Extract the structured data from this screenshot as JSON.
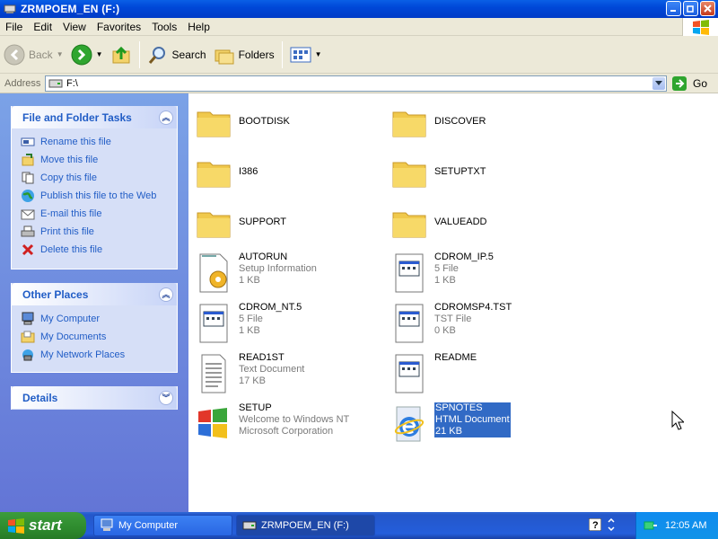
{
  "window": {
    "title": "ZRMPOEM_EN (F:)"
  },
  "menu": [
    "File",
    "Edit",
    "View",
    "Favorites",
    "Tools",
    "Help"
  ],
  "toolbar": {
    "back": "Back",
    "search": "Search",
    "folders": "Folders"
  },
  "address": {
    "label": "Address",
    "value": "F:\\",
    "go": "Go"
  },
  "tasks": {
    "file_tasks": {
      "title": "File and Folder Tasks",
      "items": [
        {
          "label": "Rename this file",
          "icon": "rename-icon"
        },
        {
          "label": "Move this file",
          "icon": "move-icon"
        },
        {
          "label": "Copy this file",
          "icon": "copy-icon"
        },
        {
          "label": "Publish this file to the Web",
          "icon": "globe-icon"
        },
        {
          "label": "E-mail this file",
          "icon": "email-icon"
        },
        {
          "label": "Print this file",
          "icon": "printer-icon"
        },
        {
          "label": "Delete this file",
          "icon": "delete-icon"
        }
      ]
    },
    "other_places": {
      "title": "Other Places",
      "items": [
        {
          "label": "My Computer",
          "icon": "computer-icon"
        },
        {
          "label": "My Documents",
          "icon": "documents-folder-icon"
        },
        {
          "label": "My Network Places",
          "icon": "network-icon"
        }
      ]
    },
    "details": {
      "title": "Details"
    }
  },
  "files": [
    {
      "name": "BOOTDISK",
      "type": "folder"
    },
    {
      "name": "DISCOVER",
      "type": "folder"
    },
    {
      "name": "I386",
      "type": "folder"
    },
    {
      "name": "SETUPTXT",
      "type": "folder"
    },
    {
      "name": "SUPPORT",
      "type": "folder"
    },
    {
      "name": "VALUEADD",
      "type": "folder"
    },
    {
      "name": "AUTORUN",
      "line2": "Setup Information",
      "line3": "1 KB",
      "type": "setup-info"
    },
    {
      "name": "CDROM_IP.5",
      "line2": "5 File",
      "line3": "1 KB",
      "type": "generic"
    },
    {
      "name": "CDROM_NT.5",
      "line2": "5 File",
      "line3": "1 KB",
      "type": "generic"
    },
    {
      "name": "CDROMSP4.TST",
      "line2": "TST File",
      "line3": "0 KB",
      "type": "generic"
    },
    {
      "name": "READ1ST",
      "line2": "Text Document",
      "line3": "17 KB",
      "type": "text"
    },
    {
      "name": "README",
      "type": "generic"
    },
    {
      "name": "SETUP",
      "line2": "Welcome to Windows NT",
      "line3": "Microsoft Corporation",
      "type": "windows-exe"
    },
    {
      "name": "SPNOTES",
      "line2": "HTML Document",
      "line3": "21 KB",
      "type": "html",
      "selected": true
    }
  ],
  "taskbar": {
    "start": "start",
    "tasks": [
      "My Computer",
      "ZRMPOEM_EN (F:)"
    ],
    "clock": "12:05 AM"
  }
}
